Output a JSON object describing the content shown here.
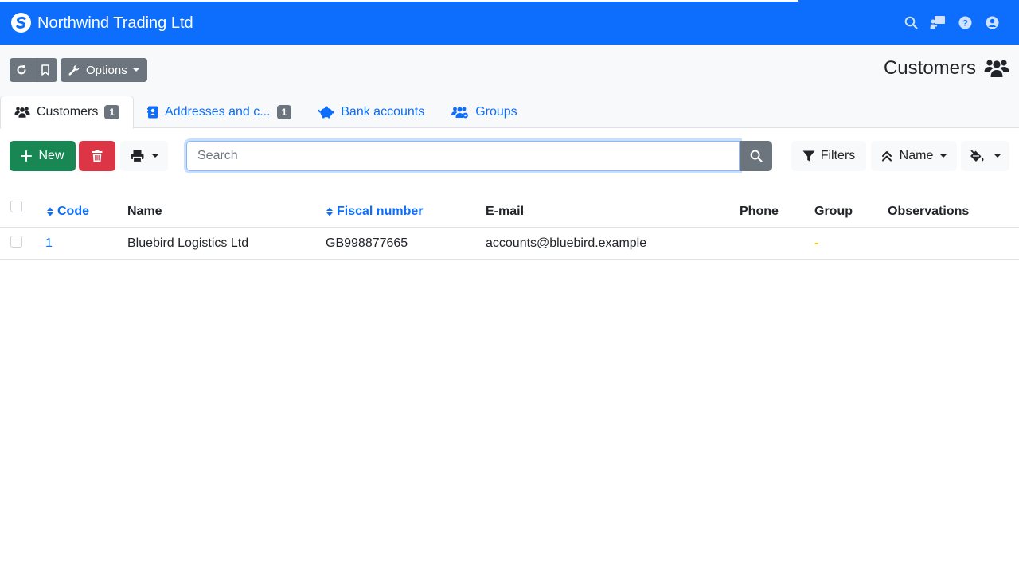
{
  "app": {
    "company_name": "Northwind Trading Ltd",
    "brand_color": "#0d6efd"
  },
  "header": {
    "options_label": "Options",
    "page_title": "Customers"
  },
  "tabs": [
    {
      "label": "Customers",
      "badge": "1",
      "active": true,
      "icon": "users-icon"
    },
    {
      "label": "Addresses and c...",
      "badge": "1",
      "active": false,
      "icon": "address-book-icon"
    },
    {
      "label": "Bank accounts",
      "active": false,
      "icon": "piggy-bank-icon"
    },
    {
      "label": "Groups",
      "active": false,
      "icon": "users-cog-icon"
    }
  ],
  "toolbar": {
    "new_label": "New",
    "search_placeholder": "Search",
    "filters_label": "Filters",
    "sort_label": "Name"
  },
  "table": {
    "columns": [
      "Code",
      "Name",
      "Fiscal number",
      "E-mail",
      "Phone",
      "Group",
      "Observations"
    ],
    "rows": [
      {
        "code": "1",
        "name": "Bluebird Logistics Ltd",
        "fiscal_number": "GB998877665",
        "email": "accounts@bluebird.example",
        "phone": "",
        "group": "-",
        "observations": ""
      }
    ]
  }
}
